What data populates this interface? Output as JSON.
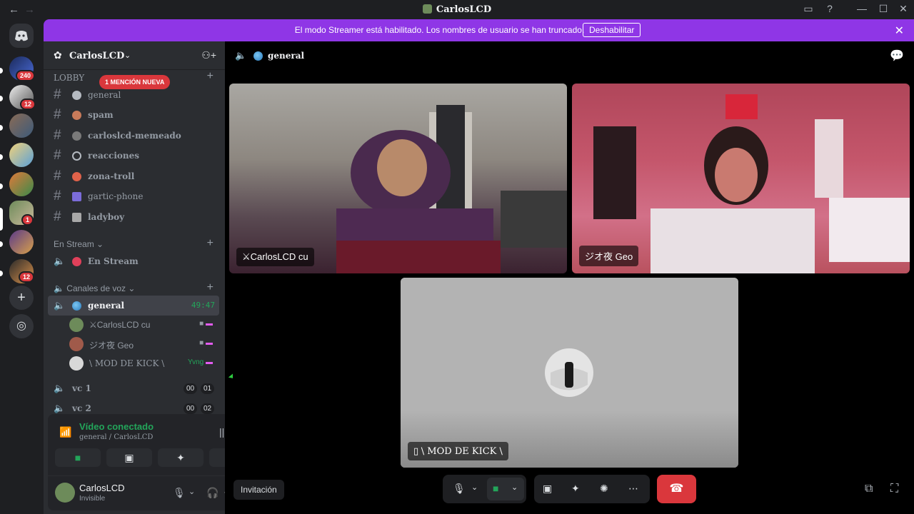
{
  "window": {
    "title": "CarlosLCD",
    "back_icon": "←",
    "forward_icon": "→"
  },
  "rail": {
    "badges": [
      "240",
      "12",
      "1",
      "12"
    ]
  },
  "banner": {
    "text": "El modo Streamer está habilitado. Los nombres de usuario se han truncado.",
    "button": "Deshabilitar"
  },
  "sidebar": {
    "guild_name": "CarlosLCD",
    "categories": {
      "lobby": "LOBBY",
      "stream": "En Stream",
      "voice": "Canales de voz"
    },
    "mention_pill": "1 MENCIÓN NUEVA",
    "text_channels": [
      {
        "name": "general",
        "emoji_color": "#b5bac1",
        "bold": false
      },
      {
        "name": "spam",
        "emoji_color": "#c97b5a",
        "bold": true
      },
      {
        "name": "carloslcd-memeado",
        "emoji_color": "#7a7a7a",
        "bold": true
      },
      {
        "name": "reacciones",
        "emoji_color": "#b5bac1",
        "bold": true
      },
      {
        "name": "zona-troll",
        "emoji_color": "#e0624a",
        "bold": true
      },
      {
        "name": "gartic-phone",
        "emoji_color": "#7b6cd9",
        "bold": false
      },
      {
        "name": "ladyboy",
        "emoji_color": "#a8a8a8",
        "bold": true
      }
    ],
    "stream_channel": "En Stream",
    "voice_channel": {
      "name": "general",
      "timer": "49:47",
      "users": [
        {
          "name": "⚔CarlosLCD cu",
          "avatar_color": "#6d8b5a"
        },
        {
          "name": "ジオ夜 Geo",
          "avatar_color": "#a05a4a"
        },
        {
          "name": "\\ MOD DE KICK \\",
          "avatar_color": "#d8d8d8",
          "activity": "Yvng"
        }
      ]
    },
    "vc_channels": [
      {
        "name": "vc 1",
        "a": "00",
        "b": "01"
      },
      {
        "name": "vc 2",
        "a": "00",
        "b": "02"
      }
    ]
  },
  "voice_panel": {
    "status": "Vídeo conectado",
    "subtitle": "general / CarlosLCD",
    "user": "CarlosLCD",
    "user_status": "Invisible"
  },
  "main": {
    "channel_title": "general",
    "tiles": [
      {
        "label": "⚔CarlosLCD cu"
      },
      {
        "label": "ジオ夜 Geo"
      },
      {
        "label": "\\ MOD DE KICK \\"
      }
    ],
    "invite_label": "Invitación"
  }
}
